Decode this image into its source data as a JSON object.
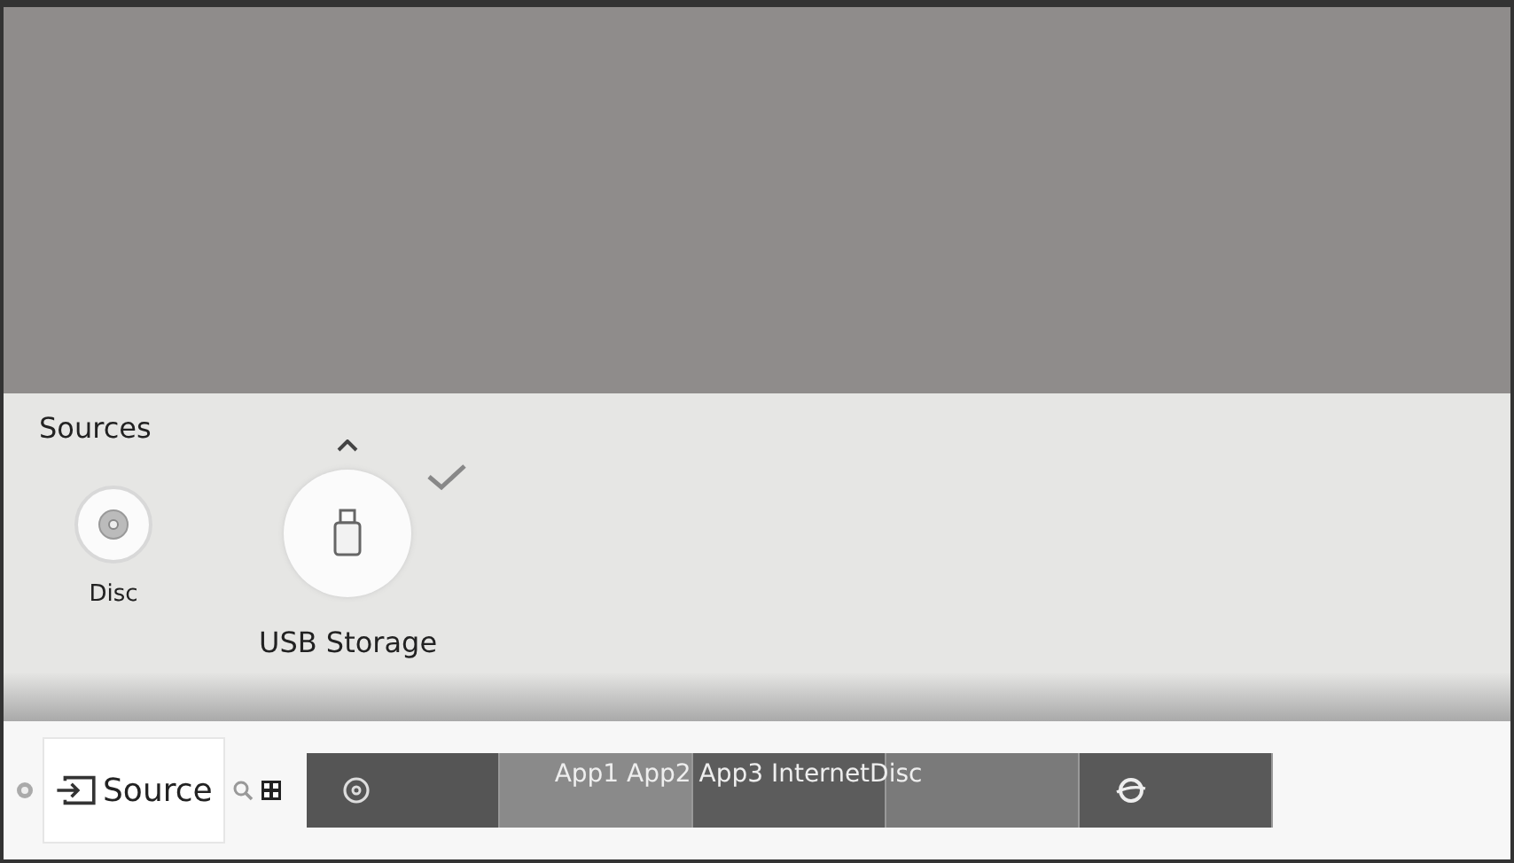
{
  "panel": {
    "title": "Sources",
    "items": [
      {
        "label": "Disc",
        "kind": "disc",
        "selected": false,
        "checked": false
      },
      {
        "label": "USB Storage",
        "kind": "usb",
        "selected": true,
        "checked": true
      }
    ]
  },
  "bar": {
    "left_icons": [
      {
        "kind": "settings"
      }
    ],
    "source_button": {
      "label": "Source",
      "selected": true
    },
    "right_icons": [
      {
        "kind": "search"
      },
      {
        "kind": "apps"
      }
    ],
    "tiles": [
      {
        "kind": "disc",
        "color": "#555555"
      },
      {
        "kind": "blank",
        "color": "#8a8a8a"
      },
      {
        "kind": "blank",
        "color": "#5c5c5c"
      },
      {
        "kind": "blank",
        "color": "#7a7a7a"
      },
      {
        "kind": "globe",
        "color": "#595959"
      }
    ],
    "tiles_caption": "App1 App2 App3 InternetDisc"
  }
}
